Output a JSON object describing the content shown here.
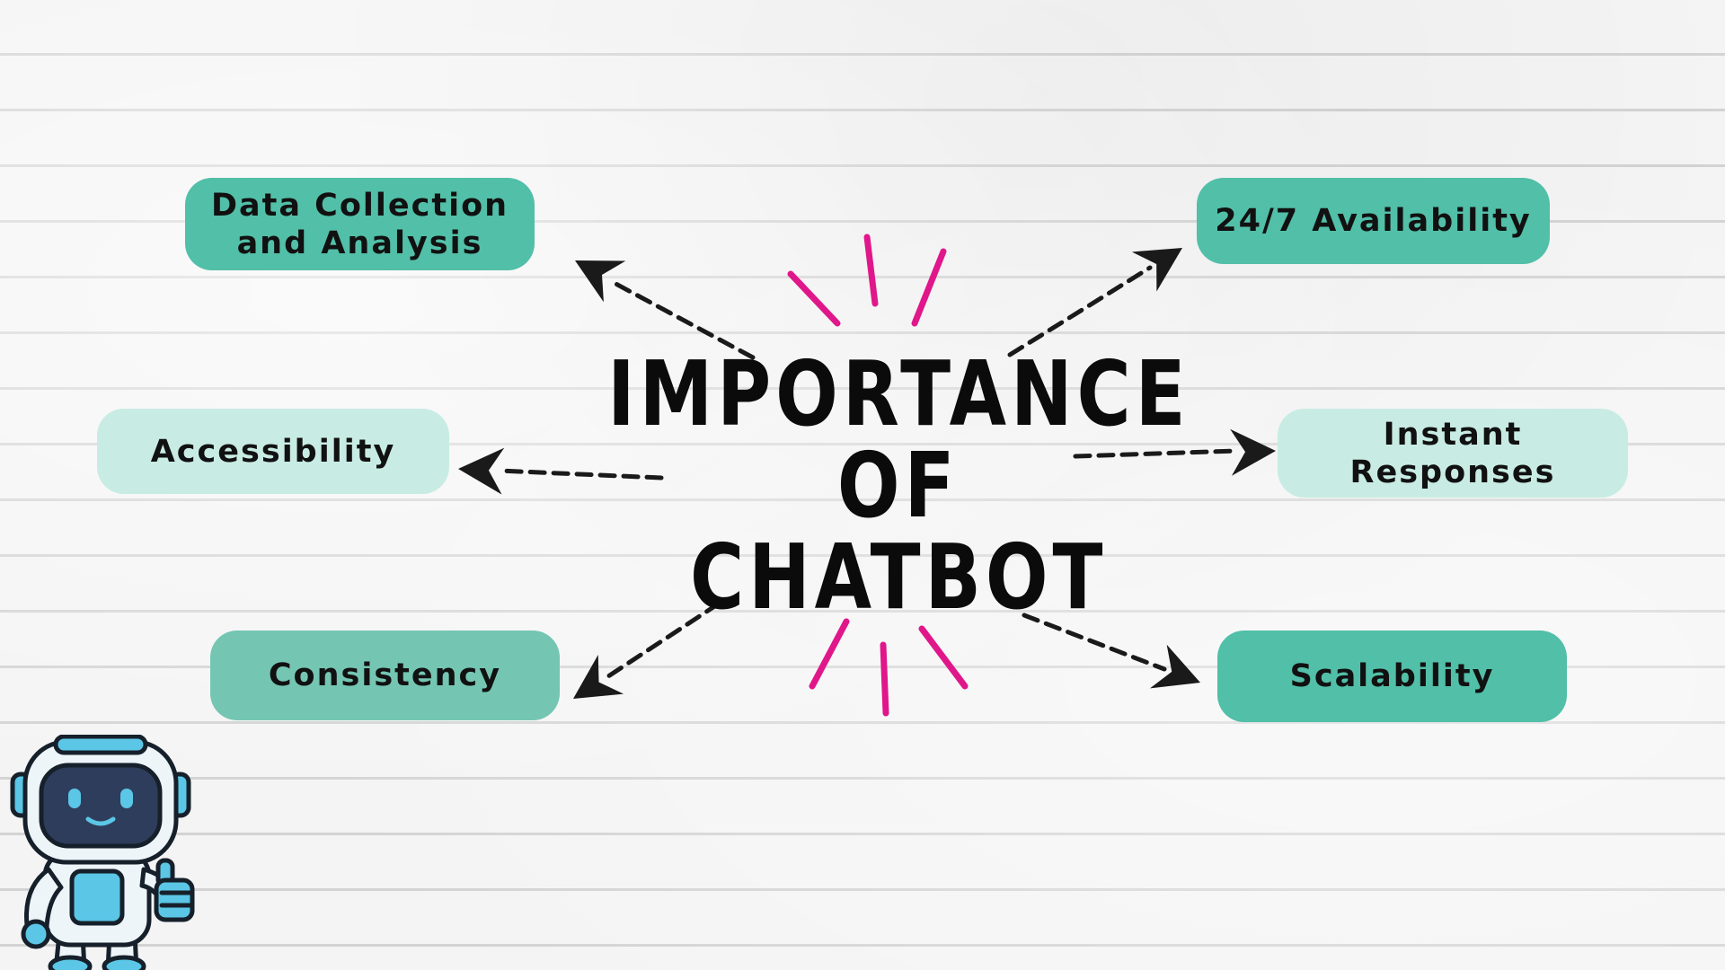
{
  "title": {
    "line1": "IMPORTANCE",
    "line2": "OF",
    "line3": "CHATBOT"
  },
  "topics": {
    "data_collection": "Data Collection and Analysis",
    "availability": "24/7 Availability",
    "accessibility": "Accessibility",
    "instant_responses": "Instant Responses",
    "consistency": "Consistency",
    "scalability": "Scalability"
  },
  "colors": {
    "teal_dark": "#52bfa8",
    "teal_medium": "#74c6b3",
    "teal_light": "#c8ece3",
    "accent_magenta": "#e0178a",
    "text_dark": "#111111",
    "robot_blue": "#5bc6e6"
  },
  "icons": {
    "robot": "robot-thumbs-up-icon",
    "arrow": "dashed-arrow-icon",
    "burst": "emphasis-burst-icon"
  }
}
